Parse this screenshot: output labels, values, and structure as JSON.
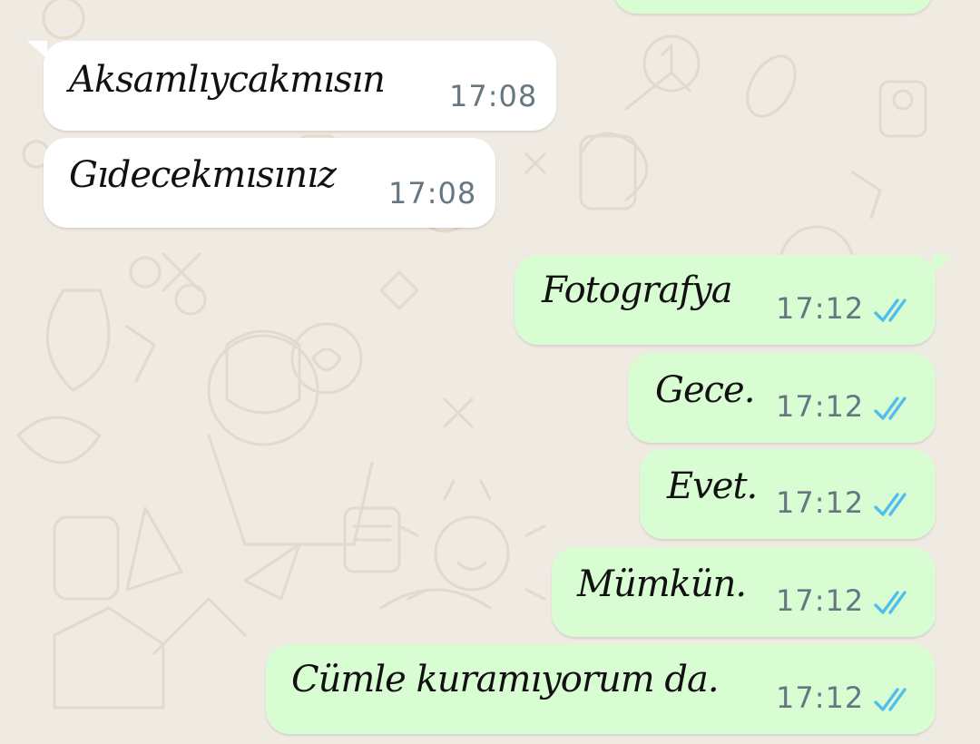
{
  "conversation": {
    "colors": {
      "background": "#efeae2",
      "incoming_bubble": "#ffffff",
      "outgoing_bubble": "#d9fdd3",
      "timestamp": "#667781",
      "read_ticks": "#53bdeb"
    },
    "messages": [
      {
        "direction": "incoming",
        "text": "Aksamlıycakmısın",
        "time": "17:08"
      },
      {
        "direction": "incoming",
        "text": "Gıdecekmısınız",
        "time": "17:08"
      },
      {
        "direction": "outgoing",
        "text": "Fotografya",
        "time": "17:12",
        "status_icon": "double-check-read-icon"
      },
      {
        "direction": "outgoing",
        "text": "Gece.",
        "time": "17:12",
        "status_icon": "double-check-read-icon"
      },
      {
        "direction": "outgoing",
        "text": "Evet.",
        "time": "17:12",
        "status_icon": "double-check-read-icon"
      },
      {
        "direction": "outgoing",
        "text": "Mümkün.",
        "time": "17:12",
        "status_icon": "double-check-read-icon"
      },
      {
        "direction": "outgoing",
        "text": "Cümle kuramıyorum da.",
        "time": "17:12",
        "status_icon": "double-check-read-icon"
      }
    ]
  }
}
